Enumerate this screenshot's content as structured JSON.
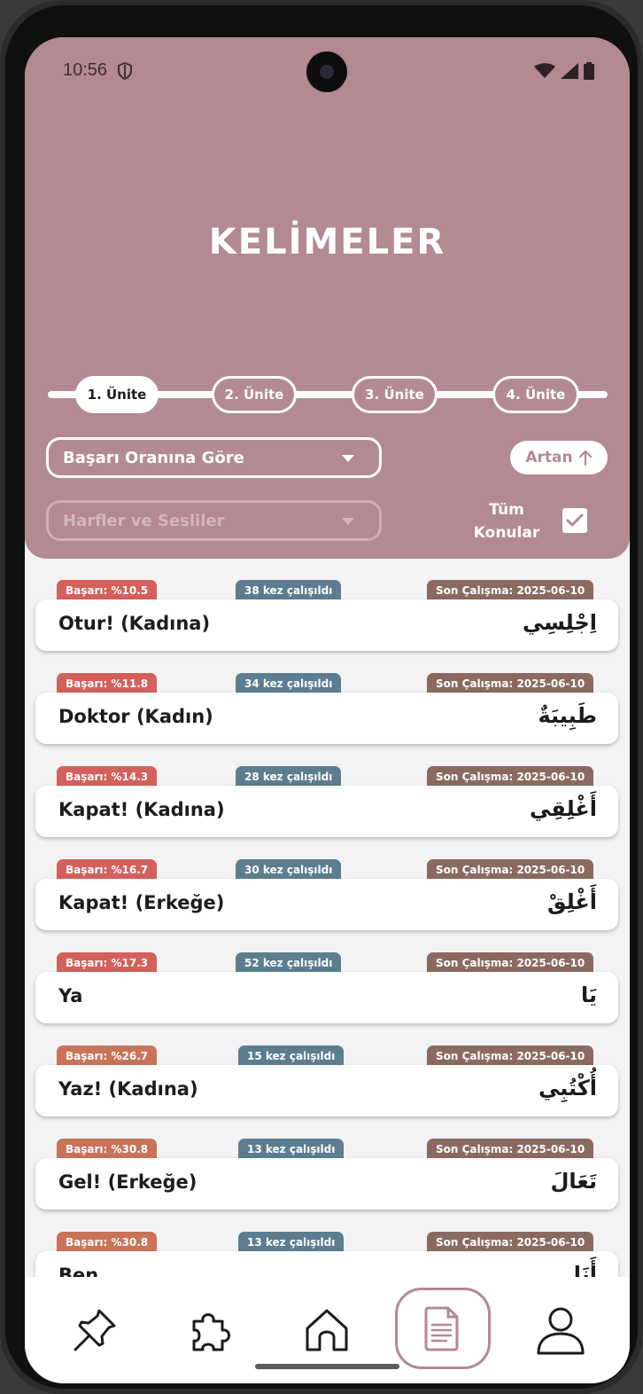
{
  "status": {
    "time": "10:56"
  },
  "header": {
    "title": "KELİMELER",
    "units": [
      "1. Ünite",
      "2. Ünite",
      "3. Ünite",
      "4. Ünite"
    ],
    "active_unit": 0,
    "sort_select": "Başarı Oranına Göre",
    "order_button": "Artan",
    "topic_select_placeholder": "Harfler ve Sesliler",
    "all_topics_line1": "Tüm",
    "all_topics_line2": "Konular",
    "all_topics_checked": true
  },
  "colors": {
    "header_bg": "#b38992",
    "success_red": "#d3605a",
    "success_orange": "#c8735a",
    "study_count_blue": "#5c7d8f",
    "last_study_brown": "#8a6a60"
  },
  "words": [
    {
      "success": "Başarı: %10.5",
      "count": "38 kez çalışıldı",
      "last": "Son Çalışma: 2025-06-10",
      "tr": "Otur! (Kadına)",
      "ar": "اِجْلِسِي"
    },
    {
      "success": "Başarı: %11.8",
      "count": "34 kez çalışıldı",
      "last": "Son Çalışma: 2025-06-10",
      "tr": "Doktor (Kadın)",
      "ar": "طَبِيبَةٌ"
    },
    {
      "success": "Başarı: %14.3",
      "count": "28 kez çalışıldı",
      "last": "Son Çalışma: 2025-06-10",
      "tr": "Kapat! (Kadına)",
      "ar": "أَغْلِقِي"
    },
    {
      "success": "Başarı: %16.7",
      "count": "30 kez çalışıldı",
      "last": "Son Çalışma: 2025-06-10",
      "tr": "Kapat! (Erkeğe)",
      "ar": "أَغْلِقْ"
    },
    {
      "success": "Başarı: %17.3",
      "count": "52 kez çalışıldı",
      "last": "Son Çalışma: 2025-06-10",
      "tr": "Ya",
      "ar": "يَا"
    },
    {
      "success": "Başarı: %26.7",
      "count": "15 kez çalışıldı",
      "last": "Son Çalışma: 2025-06-10",
      "tr": "Yaz! (Kadına)",
      "ar": "أُكْتُبِي"
    },
    {
      "success": "Başarı: %30.8",
      "count": "13 kez çalışıldı",
      "last": "Son Çalışma: 2025-06-10",
      "tr": "Gel! (Erkeğe)",
      "ar": "تَعَالَ"
    },
    {
      "success": "Başarı: %30.8",
      "count": "13 kez çalışıldı",
      "last": "Son Çalışma: 2025-06-10",
      "tr": "Ben",
      "ar": "أَنَا"
    }
  ],
  "nav": {
    "items": [
      "pin-icon",
      "puzzle-icon",
      "home-icon",
      "document-icon",
      "profile-icon"
    ],
    "active": "document-icon"
  }
}
